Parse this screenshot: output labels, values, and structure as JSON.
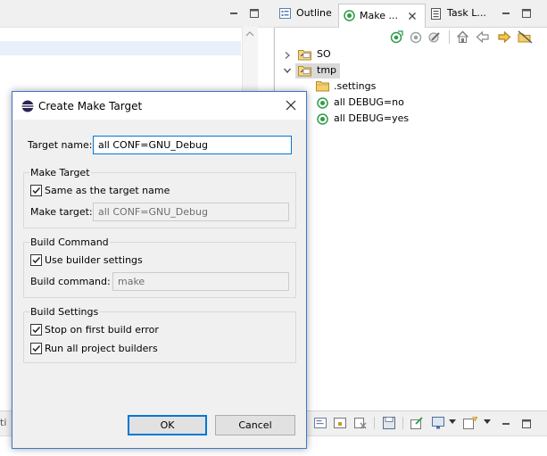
{
  "views": {
    "outline_tab": "Outline",
    "make_tab": "Make ...",
    "task_tab": "Task L...",
    "bottom_partial_text": "ti"
  },
  "tree": {
    "items": [
      {
        "label": "SO",
        "expanded": false,
        "type": "project"
      },
      {
        "label": "tmp",
        "expanded": true,
        "type": "project",
        "selected": true
      },
      {
        "label": ".settings",
        "type": "folder"
      },
      {
        "label": "all DEBUG=no",
        "type": "target"
      },
      {
        "label": "all DEBUG=yes",
        "type": "target"
      }
    ]
  },
  "dialog": {
    "title": "Create Make Target",
    "target_name_label": "Target name:",
    "target_name_value": "all CONF=GNU_Debug",
    "make_target_group": {
      "title": "Make Target",
      "same_as_label": "Same as the target name",
      "same_as_checked": true,
      "make_target_label": "Make target:",
      "make_target_value": "all CONF=GNU_Debug"
    },
    "build_command_group": {
      "title": "Build Command",
      "use_builder_label": "Use builder settings",
      "use_builder_checked": true,
      "build_command_label": "Build command:",
      "build_command_value": "make"
    },
    "build_settings_group": {
      "title": "Build Settings",
      "stop_on_error_label": "Stop on first build error",
      "stop_on_error_checked": true,
      "run_all_label": "Run all project builders",
      "run_all_checked": true
    },
    "ok_label": "OK",
    "cancel_label": "Cancel"
  },
  "colors": {
    "target_green": "#2e9b48",
    "folder_yellow": "#f2cf6a",
    "focus_blue": "#0078d7",
    "dialog_border": "#3c78c8"
  }
}
